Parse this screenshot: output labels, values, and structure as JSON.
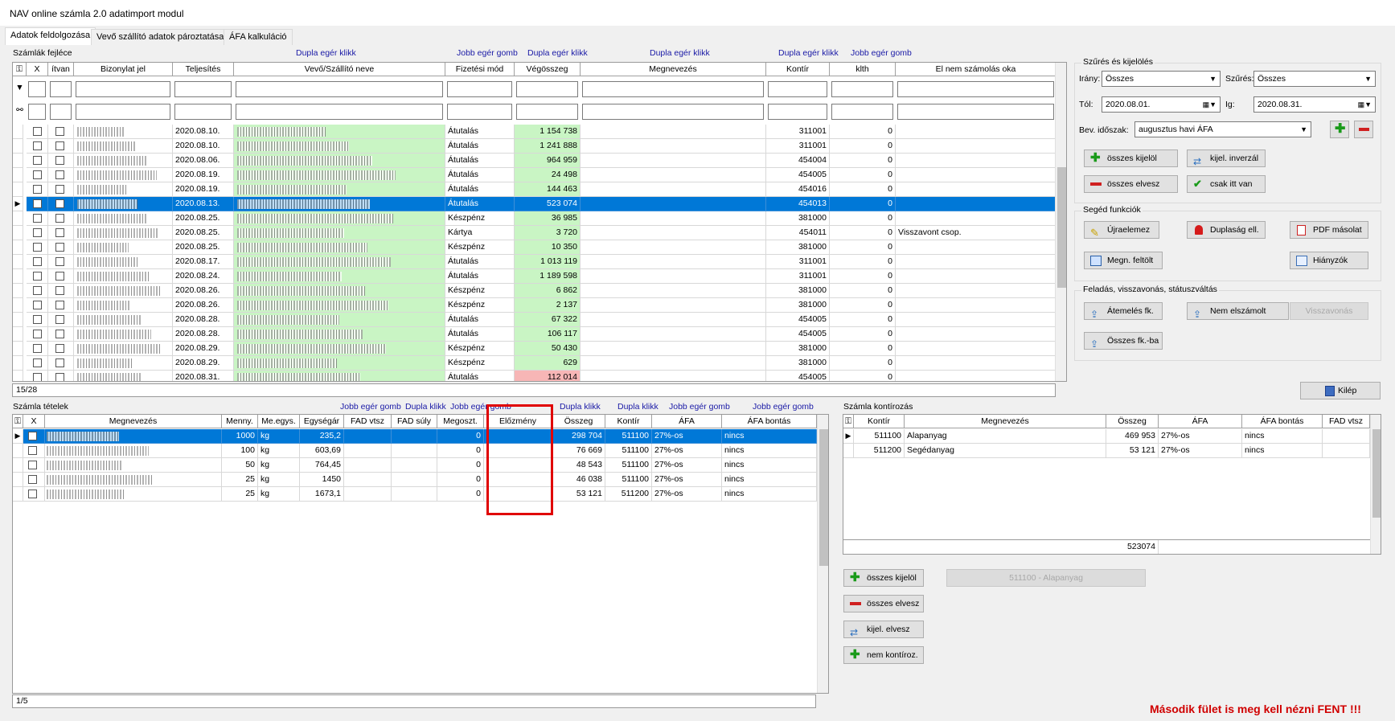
{
  "window": {
    "title": "NAV online számla 2.0 adatimport modul"
  },
  "tabs": [
    "Adatok feldolgozása",
    "Vevő szállító adatok pároztatása",
    "ÁFA kalkuláció"
  ],
  "headers_section": {
    "label": "Számlák fejléce",
    "count": "15/28",
    "hints": [
      "Dupla egér klikk",
      "Jobb egér gomb",
      "Dupla egér klikk",
      "Dupla egér klikk",
      "Dupla egér klikk",
      "Jobb egér gomb"
    ],
    "columns": [
      "X",
      "ítvan",
      "Bizonylat jel",
      "Teljesítés",
      "Vevő/Szállító neve",
      "Fizetési mód",
      "Végösszeg",
      "Megnevezés",
      "Kontír",
      "klth",
      "El nem számolás oka"
    ],
    "rows": [
      {
        "date": "2020.08.10.",
        "pay": "Átutalás",
        "total": "1 154 738",
        "kontir": "311001",
        "klth": "0",
        "reason": ""
      },
      {
        "date": "2020.08.10.",
        "pay": "Átutalás",
        "total": "1 241 888",
        "kontir": "311001",
        "klth": "0",
        "reason": ""
      },
      {
        "date": "2020.08.06.",
        "pay": "Átutalás",
        "total": "964 959",
        "kontir": "454004",
        "klth": "0",
        "reason": ""
      },
      {
        "date": "2020.08.19.",
        "pay": "Átutalás",
        "total": "24 498",
        "kontir": "454005",
        "klth": "0",
        "reason": ""
      },
      {
        "date": "2020.08.19.",
        "pay": "Átutalás",
        "total": "144 463",
        "kontir": "454016",
        "klth": "0",
        "reason": ""
      },
      {
        "date": "2020.08.13.",
        "pay": "Átutalás",
        "total": "523 074",
        "kontir": "454013",
        "klth": "0",
        "reason": ""
      },
      {
        "date": "2020.08.25.",
        "pay": "Készpénz",
        "total": "36 985",
        "kontir": "381000",
        "klth": "0",
        "reason": ""
      },
      {
        "date": "2020.08.25.",
        "pay": "Kártya",
        "total": "3 720",
        "kontir": "454011",
        "klth": "0",
        "reason": "Visszavont csop."
      },
      {
        "date": "2020.08.25.",
        "pay": "Készpénz",
        "total": "10 350",
        "kontir": "381000",
        "klth": "0",
        "reason": ""
      },
      {
        "date": "2020.08.17.",
        "pay": "Átutalás",
        "total": "1 013 119",
        "kontir": "311001",
        "klth": "0",
        "reason": ""
      },
      {
        "date": "2020.08.24.",
        "pay": "Átutalás",
        "total": "1 189 598",
        "kontir": "311001",
        "klth": "0",
        "reason": ""
      },
      {
        "date": "2020.08.26.",
        "pay": "Készpénz",
        "total": "6 862",
        "kontir": "381000",
        "klth": "0",
        "reason": ""
      },
      {
        "date": "2020.08.26.",
        "pay": "Készpénz",
        "total": "2 137",
        "kontir": "381000",
        "klth": "0",
        "reason": ""
      },
      {
        "date": "2020.08.28.",
        "pay": "Átutalás",
        "total": "67 322",
        "kontir": "454005",
        "klth": "0",
        "reason": ""
      },
      {
        "date": "2020.08.28.",
        "pay": "Átutalás",
        "total": "106 117",
        "kontir": "454005",
        "klth": "0",
        "reason": ""
      },
      {
        "date": "2020.08.29.",
        "pay": "Készpénz",
        "total": "50 430",
        "kontir": "381000",
        "klth": "0",
        "reason": ""
      },
      {
        "date": "2020.08.29.",
        "pay": "Készpénz",
        "total": "629",
        "kontir": "381000",
        "klth": "0",
        "reason": ""
      },
      {
        "date": "2020.08.31.",
        "pay": "Átutalás",
        "total": "112 014",
        "kontir": "454005",
        "klth": "0",
        "reason": ""
      }
    ]
  },
  "filter": {
    "label": "Szűrés és kijelölés",
    "irany_label": "Irány:",
    "irany": "Összes",
    "szures_label": "Szűrés:",
    "szures": "Összes",
    "tol_label": "Tól:",
    "tol": "2020.08.01.",
    "ig_label": "Ig:",
    "ig": "2020.08.31.",
    "bev_label": "Bev. időszak:",
    "bev": "augusztus havi ÁFA",
    "btn_all_select": "összes kijelöl",
    "btn_invert": "kijel. inverzál",
    "btn_all_drop": "összes elvesz",
    "btn_only_here": "csak itt van"
  },
  "helper": {
    "label": "Segéd funkciók",
    "reparse": "Újraelemez",
    "dup": "Duplaság ell.",
    "pdf": "PDF másolat",
    "megn": "Megn. feltölt",
    "missing": "Hiányzók"
  },
  "posting": {
    "label": "Feladás, visszavonás, státuszváltás",
    "transfer": "Átemelés fk.",
    "not_settled": "Nem elszámolt",
    "revoke": "Visszavonás",
    "all_fk": "Összes fk.-ba"
  },
  "exit": "Kilép",
  "items": {
    "label": "Számla tételek",
    "count": "1/5",
    "hints": [
      "Jobb egér gomb",
      "Dupla klikk",
      "Jobb egér gomb",
      "Dupla klikk",
      "Dupla klikk",
      "Jobb egér gomb",
      "Jobb egér gomb"
    ],
    "columns": [
      "X",
      "Megnevezés",
      "Menny.",
      "Me.egys.",
      "Egységár",
      "FAD vtsz",
      "FAD súly",
      "Megoszt.",
      "Előzmény",
      "Összeg",
      "Kontír",
      "ÁFA",
      "ÁFA bontás"
    ],
    "rows": [
      {
        "qty": "1000",
        "unit": "kg",
        "price": "235,2",
        "split": "0",
        "amount": "298 704",
        "kontir": "511100",
        "afa": "27%-os",
        "bontas": "nincs"
      },
      {
        "qty": "100",
        "unit": "kg",
        "price": "603,69",
        "split": "0",
        "amount": "76 669",
        "kontir": "511100",
        "afa": "27%-os",
        "bontas": "nincs"
      },
      {
        "qty": "50",
        "unit": "kg",
        "price": "764,45",
        "split": "0",
        "amount": "48 543",
        "kontir": "511100",
        "afa": "27%-os",
        "bontas": "nincs"
      },
      {
        "qty": "25",
        "unit": "kg",
        "price": "1450",
        "split": "0",
        "amount": "46 038",
        "kontir": "511100",
        "afa": "27%-os",
        "bontas": "nincs"
      },
      {
        "qty": "25",
        "unit": "kg",
        "price": "1673,1",
        "split": "0",
        "amount": "53 121",
        "kontir": "511200",
        "afa": "27%-os",
        "bontas": "nincs"
      }
    ]
  },
  "kontir": {
    "label": "Számla kontírozás",
    "columns": [
      "Kontír",
      "Megnevezés",
      "Összeg",
      "ÁFA",
      "ÁFA bontás",
      "FAD vtsz"
    ],
    "rows": [
      {
        "kontir": "511100",
        "name": "Alapanyag",
        "amount": "469 953",
        "afa": "27%-os",
        "bontas": "nincs"
      },
      {
        "kontir": "511200",
        "name": "Segédanyag",
        "amount": "53 121",
        "afa": "27%-os",
        "bontas": "nincs"
      }
    ],
    "total": "523074",
    "btn_all_select": "összes kijelöl",
    "btn_all_drop": "összes elvesz",
    "btn_sel_drop": "kijel. elvesz",
    "btn_not_kontir": "nem kontíroz.",
    "selected": "511100 - Alapanyag"
  },
  "note": "Második fület is meg kell nézni FENT !!!",
  "colors": {
    "selection": "#0078d7",
    "green": "#c9f5c4",
    "pink": "#f7b6b6",
    "note": "#d00000",
    "highlight": "#e00000"
  }
}
